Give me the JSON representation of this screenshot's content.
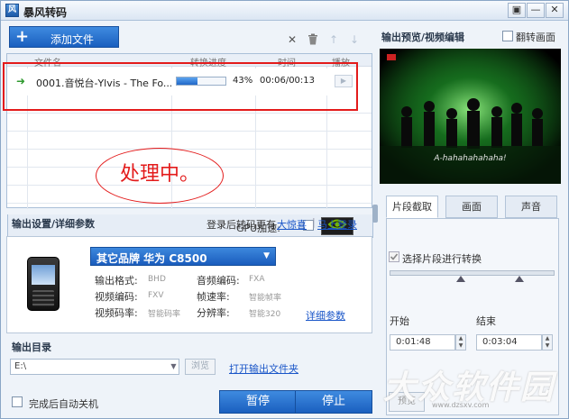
{
  "window": {
    "title": "暴风转码",
    "app_icon_glyph": "风",
    "buttons": {
      "menu": "▣",
      "minimize": "—",
      "close": "✕"
    }
  },
  "toolbar": {
    "add_icon": "+",
    "add_label": "添加文件",
    "delete_icon": "✕",
    "trash_icon": "🗑",
    "up_icon": "↑",
    "down_icon": "↓"
  },
  "file_table": {
    "columns": [
      "文件名",
      "转换进度",
      "时间",
      "播放"
    ],
    "rows": [
      {
        "status_icon": "➜",
        "name": "0001.音悦台-Ylvis - The Fo...",
        "progress": 43,
        "progress_label": "43%",
        "time": "00:06/00:13",
        "play_icon": "▶"
      }
    ],
    "annotation": "处理中。"
  },
  "gpu": {
    "label": "GPU加速:",
    "checked": false,
    "logo_icon": "nvidia-logo"
  },
  "output_settings": {
    "title": "输出设置/详细参数",
    "hint": "登录后转码更有",
    "hint_link": "大惊喜",
    "separator": "|",
    "login_link": "马上登录",
    "device": "其它品牌  华为  C8500",
    "dropdown_icon": "▼",
    "params": [
      {
        "label": "输出格式:",
        "value": "BHD"
      },
      {
        "label": "音频编码:",
        "value": "FXA"
      },
      {
        "label": "视频编码:",
        "value": "FXV"
      },
      {
        "label": "帧速率:",
        "value": "智能帧率"
      },
      {
        "label": "视频码率:",
        "value": "智能码率"
      },
      {
        "label": "分辨率:",
        "value": "智能320"
      }
    ],
    "details_link": "详细参数"
  },
  "output_dir": {
    "title": "输出目录",
    "value": "E:\\",
    "browse_label": "浏览",
    "open_link": "打开输出文件夹"
  },
  "bottom": {
    "shutdown_label": "完成后自动关机",
    "pause_label": "暂停",
    "stop_label": "停止"
  },
  "preview": {
    "title": "输出预览/视频编辑",
    "flip_label": "翻转画面",
    "subtitle": "A-hahahahahaha!",
    "channel_logo": "TV"
  },
  "edit_tabs": {
    "tabs": [
      "片段截取",
      "画面",
      "声音"
    ],
    "active": 0,
    "segment_label": "选择片段进行转换",
    "start_label": "开始",
    "end_label": "结束",
    "start_time": "0:01:48",
    "end_time": "0:03:04",
    "spin_up": "▲",
    "spin_down": "▼",
    "preview_button": "预览"
  },
  "watermark": {
    "text": "大众软件园",
    "url": "www.dzsxv.com"
  },
  "colors": {
    "accent_blue": "#1a5fbf",
    "annotation_red": "#e31b1b",
    "window_bg": "#eef3f9",
    "link_blue": "#1a56c8"
  }
}
